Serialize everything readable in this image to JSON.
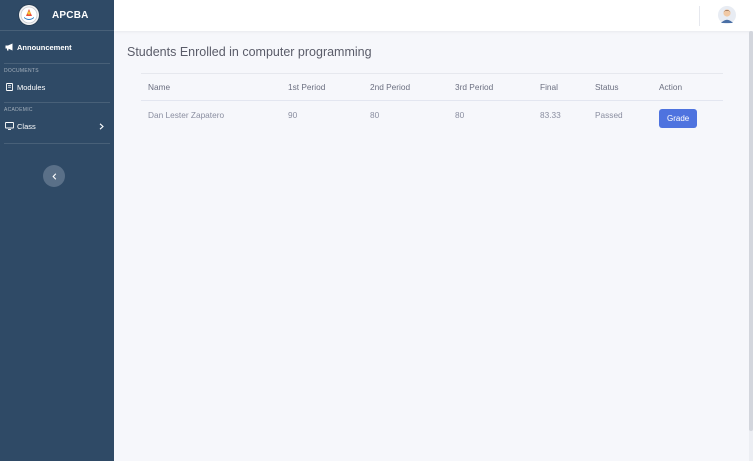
{
  "brand": {
    "name": "APCBA"
  },
  "sidebar": {
    "items": [
      {
        "label": "Announcement",
        "icon": "megaphone-icon"
      },
      {
        "section": "DOCUMENTS"
      },
      {
        "label": "Modules",
        "icon": "book-icon"
      },
      {
        "section": "ACADEMIC"
      },
      {
        "label": "Class",
        "icon": "monitor-icon"
      }
    ]
  },
  "main": {
    "title": "Students Enrolled in computer programming",
    "table": {
      "headers": [
        "Name",
        "1st Period",
        "2nd Period",
        "3rd Period",
        "Final",
        "Status",
        "Action"
      ],
      "rows": [
        {
          "name": "Dan Lester Zapatero",
          "p1": "90",
          "p2": "80",
          "p3": "80",
          "final": "83.33",
          "status": "Passed",
          "action": "Grade"
        }
      ]
    }
  },
  "colors": {
    "sidebar": "#2f4a66",
    "accent": "#4e73df",
    "background": "#f6f7fb"
  }
}
